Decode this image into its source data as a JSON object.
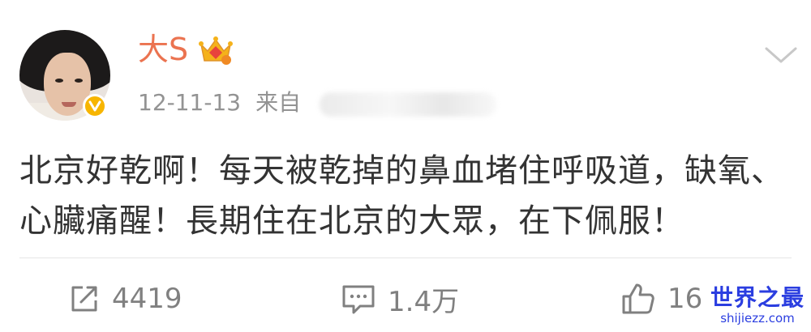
{
  "post": {
    "username": "大S",
    "time": "12-11-13",
    "source_label": "来自",
    "content": "北京好乾啊！每天被乾掉的鼻血堵住呼吸道，缺氧、心臟痛醒！長期住在北京的大眾，在下佩服！"
  },
  "actions": {
    "repost_count": "4419",
    "comment_count": "1.4万",
    "like_count": "16"
  },
  "watermark": {
    "title": "世界之最",
    "url": "shijiezz.com"
  },
  "colors": {
    "username": "#eb7350",
    "verified_badge": "#f7b500",
    "meta_text": "#939393",
    "action_text": "#808080",
    "watermark": "#2b3ee0"
  },
  "icons": [
    "crown-badge-icon",
    "verified-icon",
    "chevron-down-icon",
    "repost-icon",
    "comment-icon",
    "like-icon"
  ]
}
